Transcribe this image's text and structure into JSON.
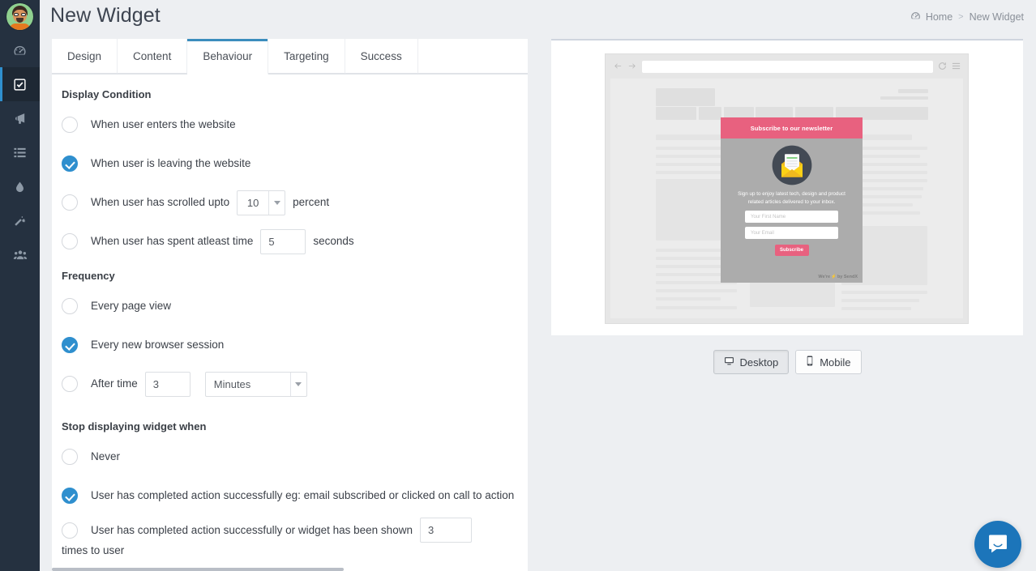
{
  "header": {
    "title": "New Widget",
    "breadcrumb": {
      "home_icon": "dashboard-icon",
      "home": "Home",
      "separator": ">",
      "current": "New Widget"
    }
  },
  "sidebar": {
    "avatar_name": "user-avatar",
    "items": [
      {
        "icon": "dashboard-icon",
        "name": "sidebar-item-dashboard",
        "active": false
      },
      {
        "icon": "check-square-icon",
        "name": "sidebar-item-widgets",
        "active": true
      },
      {
        "icon": "megaphone-icon",
        "name": "sidebar-item-campaigns",
        "active": false
      },
      {
        "icon": "list-icon",
        "name": "sidebar-item-lists",
        "active": false
      },
      {
        "icon": "droplet-icon",
        "name": "sidebar-item-drip",
        "active": false
      },
      {
        "icon": "magic-wand-icon",
        "name": "sidebar-item-automation",
        "active": false
      },
      {
        "icon": "users-icon",
        "name": "sidebar-item-contacts",
        "active": false
      }
    ]
  },
  "tabs": [
    {
      "label": "Design",
      "active": false
    },
    {
      "label": "Content",
      "active": false
    },
    {
      "label": "Behaviour",
      "active": true
    },
    {
      "label": "Targeting",
      "active": false
    },
    {
      "label": "Success",
      "active": false
    }
  ],
  "sections": {
    "display_condition": {
      "heading": "Display Condition",
      "options": [
        {
          "label": "When user enters the website",
          "checked": false
        },
        {
          "label": "When user is leaving the website",
          "checked": true
        },
        {
          "label_before": "When user has scrolled upto",
          "select_value": "10",
          "label_after": "percent",
          "checked": false
        },
        {
          "label_before": "When user has spent atleast time",
          "input_value": "5",
          "label_after": "seconds",
          "checked": false
        }
      ]
    },
    "frequency": {
      "heading": "Frequency",
      "options": [
        {
          "label": "Every page view",
          "checked": false
        },
        {
          "label": "Every new browser session",
          "checked": true
        },
        {
          "label_before": "After time",
          "input_value": "3",
          "select_value": "Minutes",
          "checked": false
        }
      ]
    },
    "stop_displaying": {
      "heading": "Stop displaying widget when",
      "options": [
        {
          "label": "Never",
          "checked": false
        },
        {
          "label": "User has completed action successfully eg: email subscribed or clicked on call to action",
          "checked": true
        },
        {
          "label_before": "User has completed action successfully or widget has been shown",
          "input_value": "3",
          "label_after": "times to user",
          "checked": false
        }
      ]
    }
  },
  "preview": {
    "browser": {
      "back_icon": "arrow-left-icon",
      "forward_icon": "arrow-right-icon",
      "url_value": "",
      "reload_icon": "reload-icon",
      "menu_icon": "hamburger-menu-icon"
    },
    "popup": {
      "title": "Subscribe to our newsletter",
      "icon": "envelope-mail-icon",
      "description": "Sign up to enjoy latest tech, design and product related articles delivered to your inbox.",
      "first_name_placeholder": "Your First Name",
      "email_placeholder": "Your Email",
      "button_label": "Subscribe",
      "footer_prefix": "We're",
      "footer_bolt": "⚡",
      "footer_suffix": "by SendX",
      "header_color": "#e8617f",
      "body_color": "#acacac",
      "button_color": "#e8617f"
    }
  },
  "device_toggle": [
    {
      "label": "Desktop",
      "icon": "desktop-icon",
      "active": true
    },
    {
      "label": "Mobile",
      "icon": "mobile-icon",
      "active": false
    }
  ],
  "chat": {
    "icon": "intercom-messenger-icon",
    "color": "#1c75ba"
  },
  "colors": {
    "accent": "#2f8fce",
    "sidebar_bg": "#253140",
    "page_bg": "#edeff2",
    "pink": "#e8617f"
  }
}
